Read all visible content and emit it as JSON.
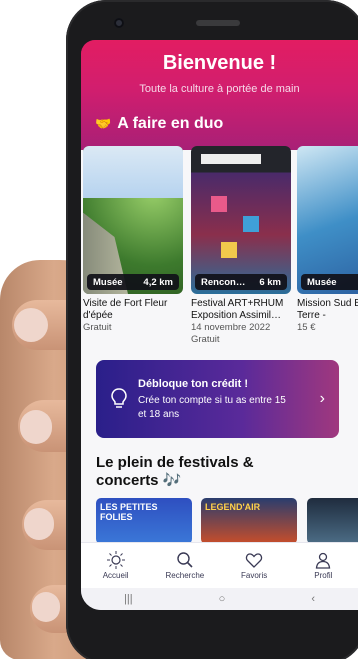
{
  "header": {
    "title": "Bienvenue !",
    "subtitle": "Toute la culture à portée de main"
  },
  "sections": {
    "duo": {
      "emoji": "🤝",
      "title": "A faire en duo"
    },
    "festivals": {
      "title": "Le plein de festivals & concerts 🎶"
    }
  },
  "cards": [
    {
      "category": "Musée",
      "distance": "4,2 km",
      "title": "Visite de Fort Fleur d'épée",
      "date": "",
      "price": "Gratuit"
    },
    {
      "category": "Rencon…",
      "distance": "6 km",
      "title": "Festival ART+RHUM Exposition Assimil…",
      "date": "14 novembre 2022",
      "price": "Gratuit"
    },
    {
      "category": "Musée",
      "distance": "",
      "title": "Mission Sud Basse-Terre -",
      "date": "",
      "price": "15 €"
    }
  ],
  "credit_banner": {
    "title": "Débloque ton crédit !",
    "text": "Crée ton compte si tu as entre 15 et 18 ans"
  },
  "festival_cards": [
    {
      "label": "LES PETITES FOLIES"
    },
    {
      "label": "LEGEND'AIR"
    },
    {
      "label": ""
    }
  ],
  "tabbar": {
    "items": [
      {
        "label": "Accueil",
        "icon": "home-sun-icon"
      },
      {
        "label": "Recherche",
        "icon": "search-icon"
      },
      {
        "label": "Favoris",
        "icon": "heart-icon"
      },
      {
        "label": "Profil",
        "icon": "user-icon"
      }
    ]
  },
  "navbar": {
    "recent": "|||",
    "home": "○",
    "back": "‹"
  },
  "colors": {
    "brand_pink": "#e21d62",
    "credit_start": "#2a1f8a",
    "credit_end": "#a0387e"
  }
}
